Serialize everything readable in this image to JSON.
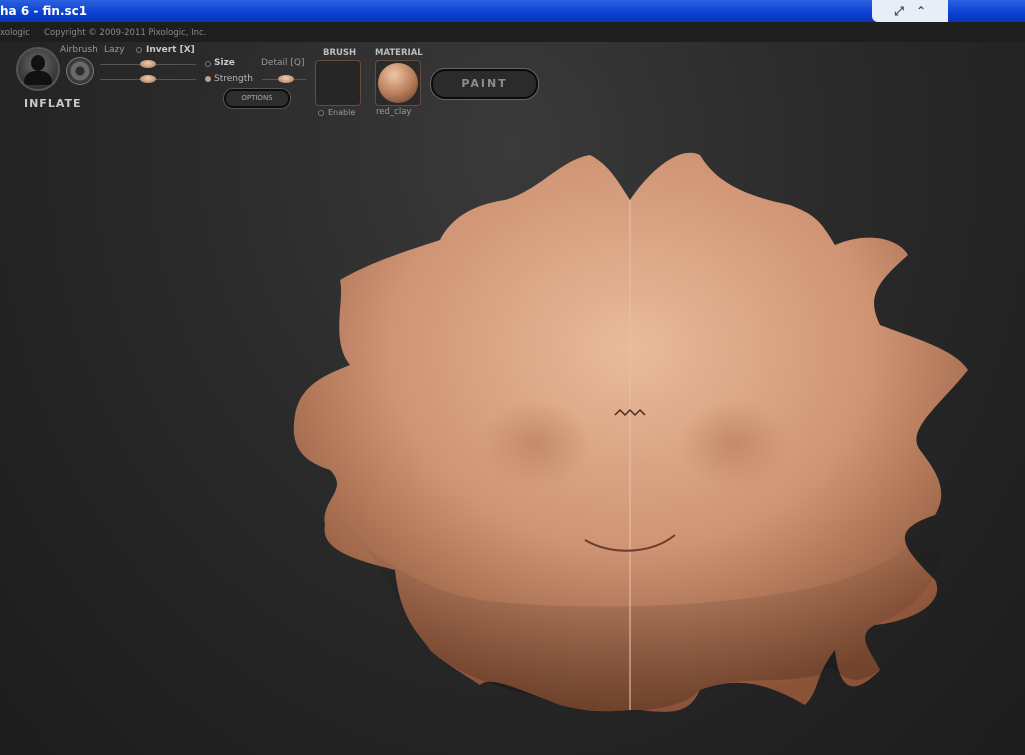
{
  "window": {
    "title": "ha 6 - fin.sc1",
    "restore_icon": "restore-icon",
    "collapse_icon": "chevron-up-icon"
  },
  "infobar": {
    "brand": "xologic",
    "copyright": "Copyright © 2009-2011 Pixologic, Inc."
  },
  "brush": {
    "name": "INFLATE",
    "airbrush_label": "Airbrush",
    "lazy_label": "Lazy",
    "invert_label": "Invert [X]",
    "size_label": "Size",
    "strength_label": "Strength",
    "detail_label": "Detail [Q]",
    "options_label": "OPTIONS",
    "brush_title": "BRUSH",
    "enable_label": "Enable",
    "material_title": "MATERIAL",
    "material_name": "red_clay",
    "paint_label": "PAINT"
  },
  "colors": {
    "titlebar": "#0a3fd0",
    "clay_light": "#e7b797",
    "clay_dark": "#8a5236",
    "accent": "#c79b7e"
  }
}
